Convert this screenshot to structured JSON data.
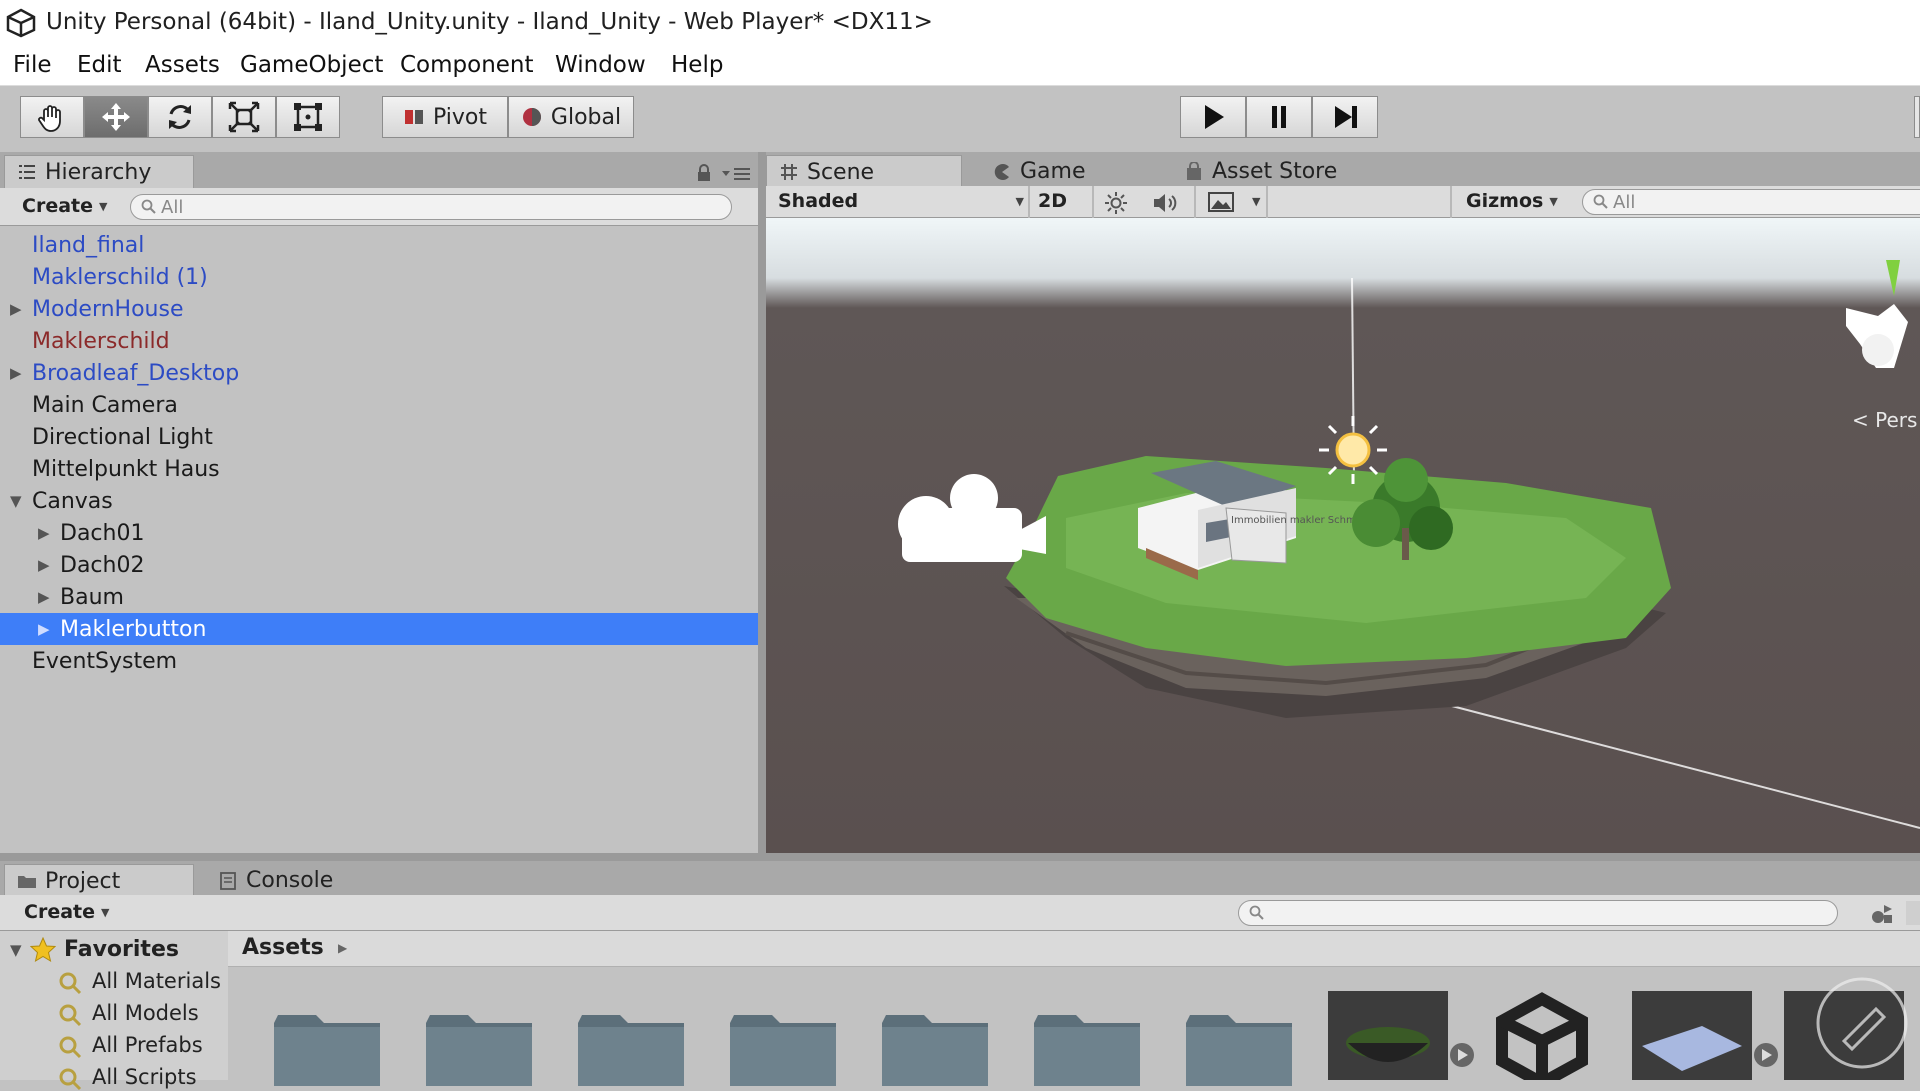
{
  "window": {
    "title": "Unity Personal (64bit) - Iland_Unity.unity - Iland_Unity - Web Player* <DX11>"
  },
  "menu": [
    "File",
    "Edit",
    "Assets",
    "GameObject",
    "Component",
    "Window",
    "Help"
  ],
  "toolbar": {
    "pivot_label": "Pivot",
    "global_label": "Global"
  },
  "hierarchy": {
    "tab_label": "Hierarchy",
    "create_label": "Create",
    "search_placeholder": "All",
    "items": [
      {
        "label": "Iland_final",
        "color": "#2c4bc4",
        "indent": 0,
        "arrow": ""
      },
      {
        "label": "Maklerschild (1)",
        "color": "#2c4bc4",
        "indent": 0,
        "arrow": ""
      },
      {
        "label": "ModernHouse",
        "color": "#2c4bc4",
        "indent": 0,
        "arrow": "▶"
      },
      {
        "label": "Maklerschild",
        "color": "#8b2a2a",
        "indent": 0,
        "arrow": ""
      },
      {
        "label": "Broadleaf_Desktop",
        "color": "#2c4bc4",
        "indent": 0,
        "arrow": "▶"
      },
      {
        "label": "Main Camera",
        "color": "#1a1a1a",
        "indent": 0,
        "arrow": ""
      },
      {
        "label": "Directional Light",
        "color": "#1a1a1a",
        "indent": 0,
        "arrow": ""
      },
      {
        "label": "Mittelpunkt Haus",
        "color": "#1a1a1a",
        "indent": 0,
        "arrow": ""
      },
      {
        "label": "Canvas",
        "color": "#1a1a1a",
        "indent": 0,
        "arrow": "▼"
      },
      {
        "label": "Dach01",
        "color": "#1a1a1a",
        "indent": 1,
        "arrow": "▶"
      },
      {
        "label": "Dach02",
        "color": "#1a1a1a",
        "indent": 1,
        "arrow": "▶"
      },
      {
        "label": "Baum",
        "color": "#1a1a1a",
        "indent": 1,
        "arrow": "▶"
      },
      {
        "label": "Maklerbutton",
        "color": "#ffffff",
        "indent": 1,
        "arrow": "▶",
        "selected": true
      },
      {
        "label": "EventSystem",
        "color": "#1a1a1a",
        "indent": 0,
        "arrow": ""
      }
    ]
  },
  "scene": {
    "tabs": [
      "Scene",
      "Game",
      "Asset Store"
    ],
    "shading": "Shaded",
    "mode_2d": "2D",
    "gizmos_label": "Gizmos",
    "search_placeholder": "All",
    "persp_label": "< Pers",
    "sign_text": "Immobilien makler Schmidt"
  },
  "project": {
    "tabs": [
      "Project",
      "Console"
    ],
    "create_label": "Create",
    "favorites_label": "Favorites",
    "favorites": [
      "All Materials",
      "All Models",
      "All Prefabs",
      "All Scripts"
    ],
    "assets_label": "Assets"
  }
}
